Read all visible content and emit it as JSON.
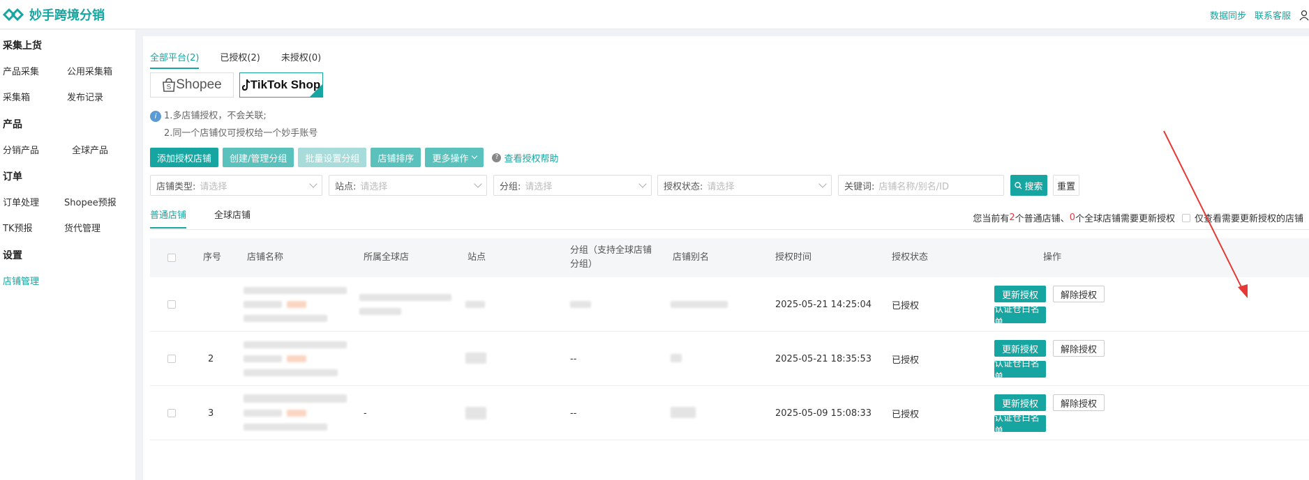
{
  "app": {
    "name": "妙手跨境分销"
  },
  "topbar": {
    "sync": "数据同步",
    "support": "联系客服"
  },
  "sidebar": {
    "groups": [
      {
        "title": "采集上货",
        "items": [
          "产品采集",
          "公用采集箱",
          "采集箱",
          "发布记录"
        ]
      },
      {
        "title": "产品",
        "items": [
          "分销产品",
          "全球产品"
        ]
      },
      {
        "title": "订单",
        "items": [
          "订单处理",
          "Shopee预报",
          "TK预报",
          "货代管理"
        ]
      },
      {
        "title": "设置",
        "items": [
          "店铺管理"
        ]
      }
    ]
  },
  "platform_tabs": [
    "全部平台(2)",
    "已授权(2)",
    "未授权(0)"
  ],
  "platforms": {
    "shopee": "Shopee",
    "tiktok": "TikTok Shop"
  },
  "tips": [
    "1.多店铺授权，不会关联;",
    "2.同一个店铺仅可授权给一个妙手账号"
  ],
  "buttons": {
    "add": "添加授权店铺",
    "group": "创建/管理分组",
    "batch": "批量设置分组",
    "sort": "店铺排序",
    "more": "更多操作",
    "help": "查看授权帮助"
  },
  "filters": {
    "shop_type": {
      "label": "店铺类型:",
      "placeholder": "请选择"
    },
    "site": {
      "label": "站点:",
      "placeholder": "请选择"
    },
    "group": {
      "label": "分组:",
      "placeholder": "请选择"
    },
    "auth_status": {
      "label": "授权状态:",
      "placeholder": "请选择"
    },
    "keyword": {
      "label": "关键词:",
      "placeholder": "店铺名称/别名/ID"
    },
    "search": "搜索",
    "reset": "重置"
  },
  "shop_tabs": [
    "普通店铺",
    "全球店铺"
  ],
  "notice": {
    "prefix": "您当前有",
    "normal_count": "2",
    "mid": "个普通店铺、",
    "global_count": "0",
    "suffix": "个全球店铺需要更新授权",
    "checkbox_label": "仅查看需要更新授权的店铺"
  },
  "table": {
    "headers": [
      "序号",
      "店铺名称",
      "所属全球店",
      "站点",
      "分组（支持全球店铺分组）",
      "店铺别名",
      "授权时间",
      "授权状态",
      "操作"
    ],
    "rows": [
      {
        "index": "",
        "global": "",
        "group": "",
        "time": "2025-05-21 14:25:04",
        "status": "已授权"
      },
      {
        "index": "2",
        "global": "",
        "group": "--",
        "time": "2025-05-21 18:35:53",
        "status": "已授权"
      },
      {
        "index": "3",
        "global": "-",
        "group": "--",
        "time": "2025-05-09 15:08:33",
        "status": "已授权"
      }
    ],
    "actions": {
      "renew": "更新授权",
      "revoke": "解除授权",
      "whitelist": "认证仓白名单"
    }
  },
  "colors": {
    "accent": "#16a5a0",
    "warning": "#e4393c"
  },
  "icons": [
    "logo-icon",
    "user-icon",
    "info-icon",
    "question-icon",
    "search-icon",
    "chevron-down-icon"
  ]
}
